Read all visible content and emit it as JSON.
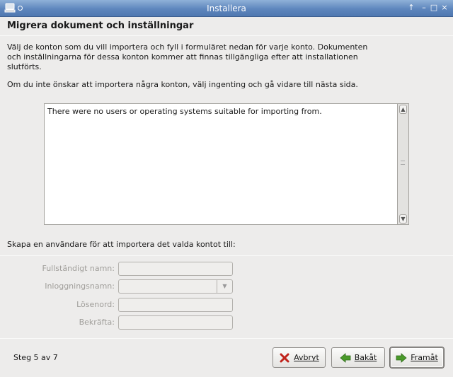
{
  "window": {
    "title": "Installera"
  },
  "page": {
    "heading": "Migrera dokument och inställningar",
    "intro": "Välj de konton som du vill importera och fyll i formuläret nedan för varje konto. Dokumenten och inställningarna för dessa konton kommer att finnas tillgängliga efter att installationen slutförts.",
    "hint": "Om du inte önskar att importera några konton, välj ingenting och gå vidare till nästa sida.",
    "list_message": "There were no users or operating systems suitable for importing from.",
    "create_label": "Skapa en användare för att importera det valda kontot till:"
  },
  "form": {
    "fullname_label": "Fullständigt namn:",
    "username_label": "Inloggningsnamn:",
    "password_label": "Lösenord:",
    "confirm_label": "Bekräfta:"
  },
  "footer": {
    "step": "Steg 5 av 7",
    "cancel_label": "Avbryt",
    "back_label": "Bakåt",
    "forward_label": "Framåt"
  },
  "colors": {
    "titlebar": "#5e86bd",
    "background": "#edeceb",
    "cancel_icon": "#c0231b",
    "nav_icon": "#4a9a2a"
  },
  "icons": [
    "installer-app-icon",
    "window-menu-icon",
    "scroll-up-icon",
    "scroll-down-icon",
    "combo-arrow-icon",
    "cancel-x-icon",
    "back-arrow-icon",
    "forward-arrow-icon"
  ]
}
